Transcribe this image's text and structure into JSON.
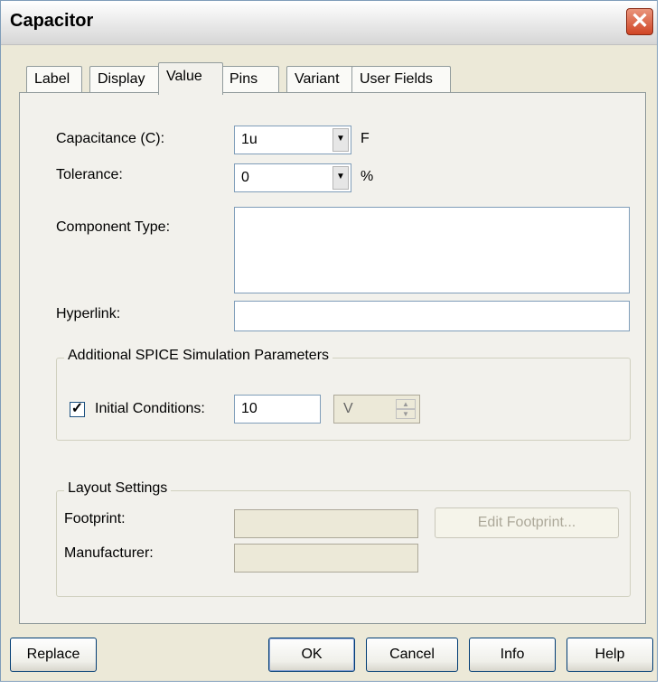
{
  "window": {
    "title": "Capacitor"
  },
  "tabs": [
    "Label",
    "Display",
    "Value",
    "Pins",
    "Variant",
    "User Fields"
  ],
  "active_tab": "Value",
  "value_tab": {
    "capacitance_label": "Capacitance (C):",
    "capacitance_value": "1u",
    "capacitance_unit": "F",
    "tolerance_label": "Tolerance:",
    "tolerance_value": "0",
    "tolerance_unit": "%",
    "component_type_label": "Component Type:",
    "component_type_value": "",
    "hyperlink_label": "Hyperlink:",
    "hyperlink_value": ""
  },
  "spice_group": {
    "title": "Additional SPICE Simulation Parameters",
    "initial_conditions_label": "Initial Conditions:",
    "initial_conditions_checked": true,
    "initial_conditions_value": "10",
    "initial_conditions_unit": "V"
  },
  "layout_group": {
    "title": "Layout Settings",
    "footprint_label": "Footprint:",
    "footprint_value": "",
    "manufacturer_label": "Manufacturer:",
    "manufacturer_value": "",
    "edit_footprint_label": "Edit Footprint..."
  },
  "buttons": {
    "replace": "Replace",
    "ok": "OK",
    "cancel": "Cancel",
    "info": "Info",
    "help": "Help"
  },
  "icons": {
    "close": "close-icon",
    "dropdown": "chevron-down-icon",
    "check": "checkmark-icon",
    "spinner": "spinner-arrows-icon"
  }
}
